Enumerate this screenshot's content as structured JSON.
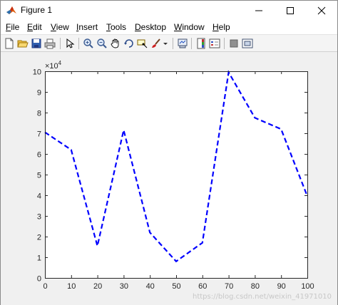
{
  "window": {
    "title": "Figure 1"
  },
  "menu": {
    "items": [
      {
        "pre": "",
        "u": "F",
        "post": "ile"
      },
      {
        "pre": "",
        "u": "E",
        "post": "dit"
      },
      {
        "pre": "",
        "u": "V",
        "post": "iew"
      },
      {
        "pre": "",
        "u": "I",
        "post": "nsert"
      },
      {
        "pre": "",
        "u": "T",
        "post": "ools"
      },
      {
        "pre": "",
        "u": "D",
        "post": "esktop"
      },
      {
        "pre": "",
        "u": "W",
        "post": "indow"
      },
      {
        "pre": "",
        "u": "H",
        "post": "elp"
      }
    ]
  },
  "toolbar": {
    "icons": [
      "new-figure-icon",
      "open-file-icon",
      "save-icon",
      "print-icon",
      "edit-plot-arrow-icon",
      "zoom-in-icon",
      "zoom-out-icon",
      "pan-hand-icon",
      "rotate-3d-icon",
      "data-cursor-icon",
      "brush-icon",
      "dropdown-arrow-icon",
      "link-plot-icon",
      "colorbar-icon",
      "legend-icon",
      "hide-plot-tools-icon",
      "show-plot-tools-icon"
    ]
  },
  "chart_data": {
    "type": "line",
    "title": "",
    "xlabel": "",
    "ylabel": "",
    "exponent_label": "×10",
    "exponent_power": "4",
    "x": [
      0,
      10,
      20,
      30,
      40,
      50,
      60,
      70,
      80,
      90,
      100
    ],
    "series": [
      {
        "values": [
          7.05,
          6.2,
          1.55,
          7.15,
          2.2,
          0.8,
          1.7,
          9.95,
          7.75,
          7.2,
          3.95
        ],
        "color": "#0000ff",
        "line_style": "dashed"
      }
    ],
    "xlim": [
      0,
      100
    ],
    "ylim": [
      0,
      10
    ],
    "xticks": [
      "0",
      "10",
      "20",
      "30",
      "40",
      "50",
      "60",
      "70",
      "80",
      "90",
      "100"
    ],
    "yticks": [
      "0",
      "1",
      "2",
      "3",
      "4",
      "5",
      "6",
      "7",
      "8",
      "9",
      "10"
    ],
    "grid": false,
    "legend": "none"
  },
  "watermark": "https://blog.csdn.net/weixin_41971010"
}
